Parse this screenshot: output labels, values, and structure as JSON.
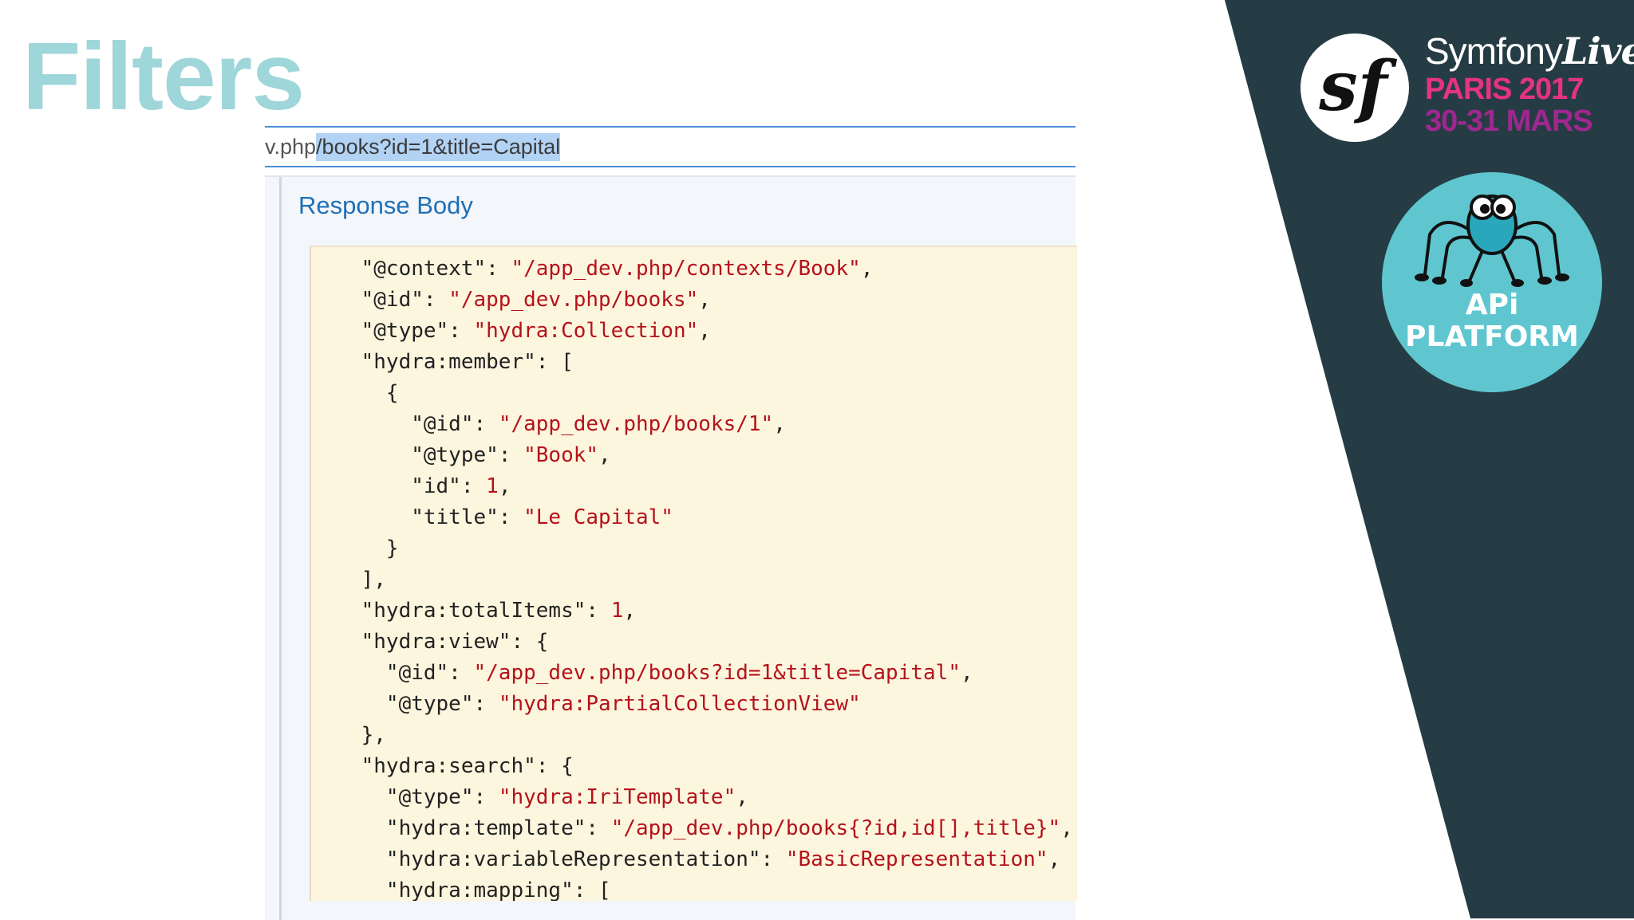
{
  "slide": {
    "title": "Filters"
  },
  "browser": {
    "url_prefix": "v.php",
    "url_selected": "/books?id=1&title=Capital"
  },
  "response": {
    "title": "Response Body",
    "lines": [
      {
        "text": "\"@context\": ",
        "value": "\"/app_dev.php/contexts/Book\"",
        "tail": ","
      },
      {
        "text": "\"@id\": ",
        "value": "\"/app_dev.php/books\"",
        "tail": ","
      },
      {
        "text": "\"@type\": ",
        "value": "\"hydra:Collection\"",
        "tail": ","
      },
      {
        "text": "\"hydra:member\": [",
        "value": "",
        "tail": ""
      },
      {
        "text": "  {",
        "value": "",
        "tail": ""
      },
      {
        "text": "    \"@id\": ",
        "value": "\"/app_dev.php/books/1\"",
        "tail": ","
      },
      {
        "text": "    \"@type\": ",
        "value": "\"Book\"",
        "tail": ","
      },
      {
        "text": "    \"id\": ",
        "value": "1",
        "tail": ","
      },
      {
        "text": "    \"title\": ",
        "value": "\"Le Capital\"",
        "tail": ""
      },
      {
        "text": "  }",
        "value": "",
        "tail": ""
      },
      {
        "text": "],",
        "value": "",
        "tail": ""
      },
      {
        "text": "\"hydra:totalItems\": ",
        "value": "1",
        "tail": ","
      },
      {
        "text": "\"hydra:view\": {",
        "value": "",
        "tail": ""
      },
      {
        "text": "  \"@id\": ",
        "value": "\"/app_dev.php/books?id=1&title=Capital\"",
        "tail": ","
      },
      {
        "text": "  \"@type\": ",
        "value": "\"hydra:PartialCollectionView\"",
        "tail": ""
      },
      {
        "text": "},",
        "value": "",
        "tail": ""
      },
      {
        "text": "\"hydra:search\": {",
        "value": "",
        "tail": ""
      },
      {
        "text": "  \"@type\": ",
        "value": "\"hydra:IriTemplate\"",
        "tail": ","
      },
      {
        "text": "  \"hydra:template\": ",
        "value": "\"/app_dev.php/books{?id,id[],title}\"",
        "tail": ","
      },
      {
        "text": "  \"hydra:variableRepresentation\": ",
        "value": "\"BasicRepresentation\"",
        "tail": ","
      },
      {
        "text": "  \"hydra:mapping\": [",
        "value": "",
        "tail": ""
      }
    ]
  },
  "brand": {
    "symfony": "Symfony",
    "live": "Live",
    "event": "PARIS 2017",
    "dates": "30-31 MARS",
    "api_line1": "APi",
    "api_line2": "PLATFORM"
  },
  "colors": {
    "title": "#9ed6da",
    "dark_panel": "#263c44",
    "json_value": "#b5121b",
    "code_bg": "#fdf6de",
    "accent_blue": "#1f6fb5",
    "event_pink": "#e6337f",
    "dates_purple": "#a0278f",
    "api_teal": "#5fc6d0"
  },
  "icons": {
    "symfony_logo": "symfony-sf-logo",
    "api_platform_logo": "api-platform-spider-logo"
  }
}
